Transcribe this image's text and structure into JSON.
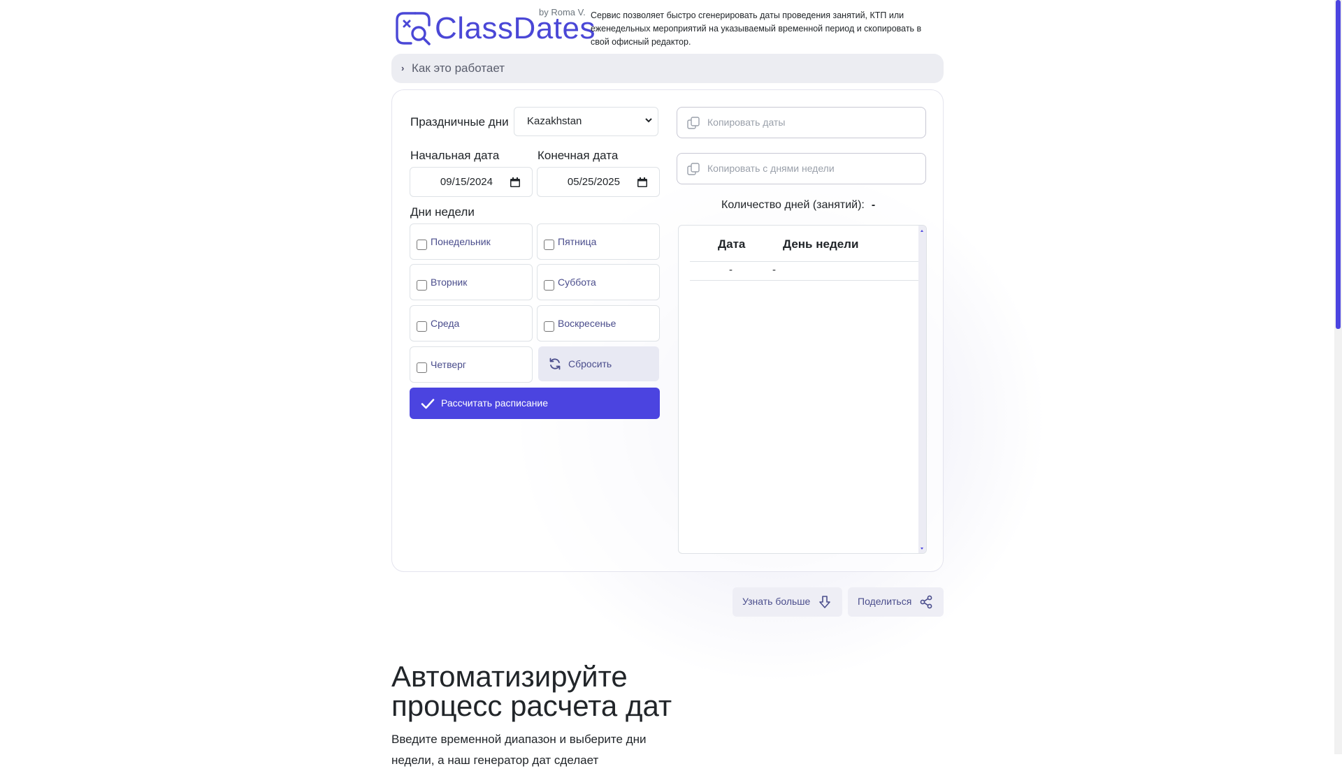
{
  "header": {
    "brand": "ClassDates",
    "by": "by Roma V.",
    "description": "Сервис позволяет быстро сгенерировать даты проведения занятий, КТП или еженедельных мероприятий на указываемый временной период и скопировать в свой офисный редактор."
  },
  "accordion": {
    "label": "Как это работает"
  },
  "form": {
    "holidays_label": "Праздничные дни",
    "country": "Kazakhstan",
    "start_label": "Начальная дата",
    "end_label": "Конечная дата",
    "start_date": "09/15/2024",
    "end_date": "05/25/2025",
    "weekdays_label": "Дни недели",
    "days": [
      "Понедельник",
      "Пятница",
      "Вторник",
      "Суббота",
      "Среда",
      "Воскресенье",
      "Четверг"
    ],
    "reset_label": "Сбросить",
    "calc_label": "Рассчитать расписание"
  },
  "results": {
    "copy_dates_placeholder": "Копировать даты",
    "copy_weekdays_placeholder": "Копировать с днями недели",
    "count_label": "Количество дней (занятий):",
    "count_value": "-",
    "table": {
      "columns": [
        "Дата",
        "День недели"
      ],
      "rows": [
        [
          "-",
          "-"
        ]
      ]
    }
  },
  "actions": {
    "learn_more": "Узнать больше",
    "share": "Поделиться"
  },
  "hero": {
    "title_line1": "Автоматизируйте",
    "title_line2": "процесс расчета дат",
    "subtitle": "Введите временной диапазон и выберите дни недели, а наш генератор дат сделает"
  },
  "colors": {
    "accent": "#4b44e0",
    "brand": "#4a47d6",
    "muted_bg": "#ecedf2"
  }
}
